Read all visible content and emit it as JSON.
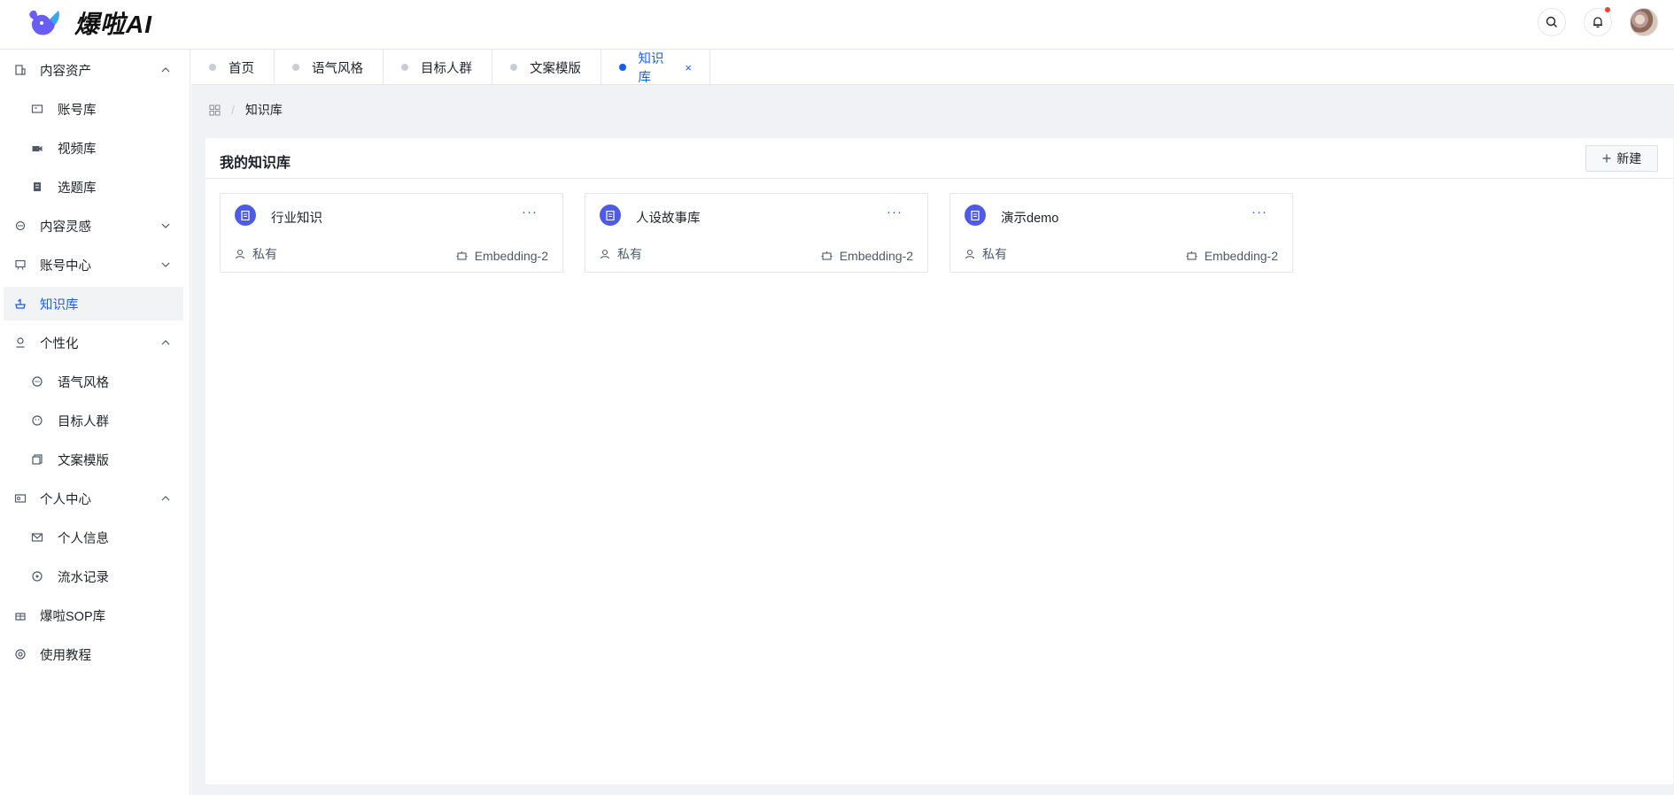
{
  "app": {
    "title": "爆啦AI"
  },
  "colors": {
    "accent": "#165dff",
    "kb_icon": "#4e5ae8",
    "notification_dot": "#f53f3f"
  },
  "sidebar": {
    "items": [
      {
        "label": "内容资产",
        "icon": "building-icon",
        "expanded": true
      },
      {
        "label": "账号库",
        "icon": "id-card-icon"
      },
      {
        "label": "视频库",
        "icon": "camera-icon"
      },
      {
        "label": "选题库",
        "icon": "clipboard-icon"
      },
      {
        "label": "内容灵感",
        "icon": "inspiration-icon",
        "expanded": false
      },
      {
        "label": "账号中心",
        "icon": "board-icon",
        "expanded": false
      },
      {
        "label": "知识库",
        "icon": "knowledge-icon",
        "active": true
      },
      {
        "label": "个性化",
        "icon": "user-pin-icon",
        "expanded": true
      },
      {
        "label": "语气风格",
        "icon": "chat-bubble-icon"
      },
      {
        "label": "目标人群",
        "icon": "face-icon"
      },
      {
        "label": "文案模版",
        "icon": "copy-icon"
      },
      {
        "label": "个人中心",
        "icon": "profile-card-icon",
        "expanded": true
      },
      {
        "label": "个人信息",
        "icon": "envelope-icon"
      },
      {
        "label": "流水记录",
        "icon": "target-icon"
      },
      {
        "label": "爆啦SOP库",
        "icon": "gift-icon"
      },
      {
        "label": "使用教程",
        "icon": "lifebuoy-icon"
      }
    ]
  },
  "tabs": [
    {
      "label": "首页"
    },
    {
      "label": "语气风格"
    },
    {
      "label": "目标人群"
    },
    {
      "label": "文案模版"
    },
    {
      "label": "知识库",
      "active": true,
      "close": "×"
    }
  ],
  "breadcrumb": {
    "current": "知识库",
    "separator": "/"
  },
  "panel": {
    "title": "我的知识库",
    "new_button": "新建",
    "new_icon": "+"
  },
  "cards": [
    {
      "name": "行业知识",
      "more": "···",
      "visibility": "私有",
      "model": "Embedding-2"
    },
    {
      "name": "人设故事库",
      "more": "···",
      "visibility": "私有",
      "model": "Embedding-2"
    },
    {
      "name": "演示demo",
      "more": "···",
      "visibility": "私有",
      "model": "Embedding-2"
    }
  ]
}
